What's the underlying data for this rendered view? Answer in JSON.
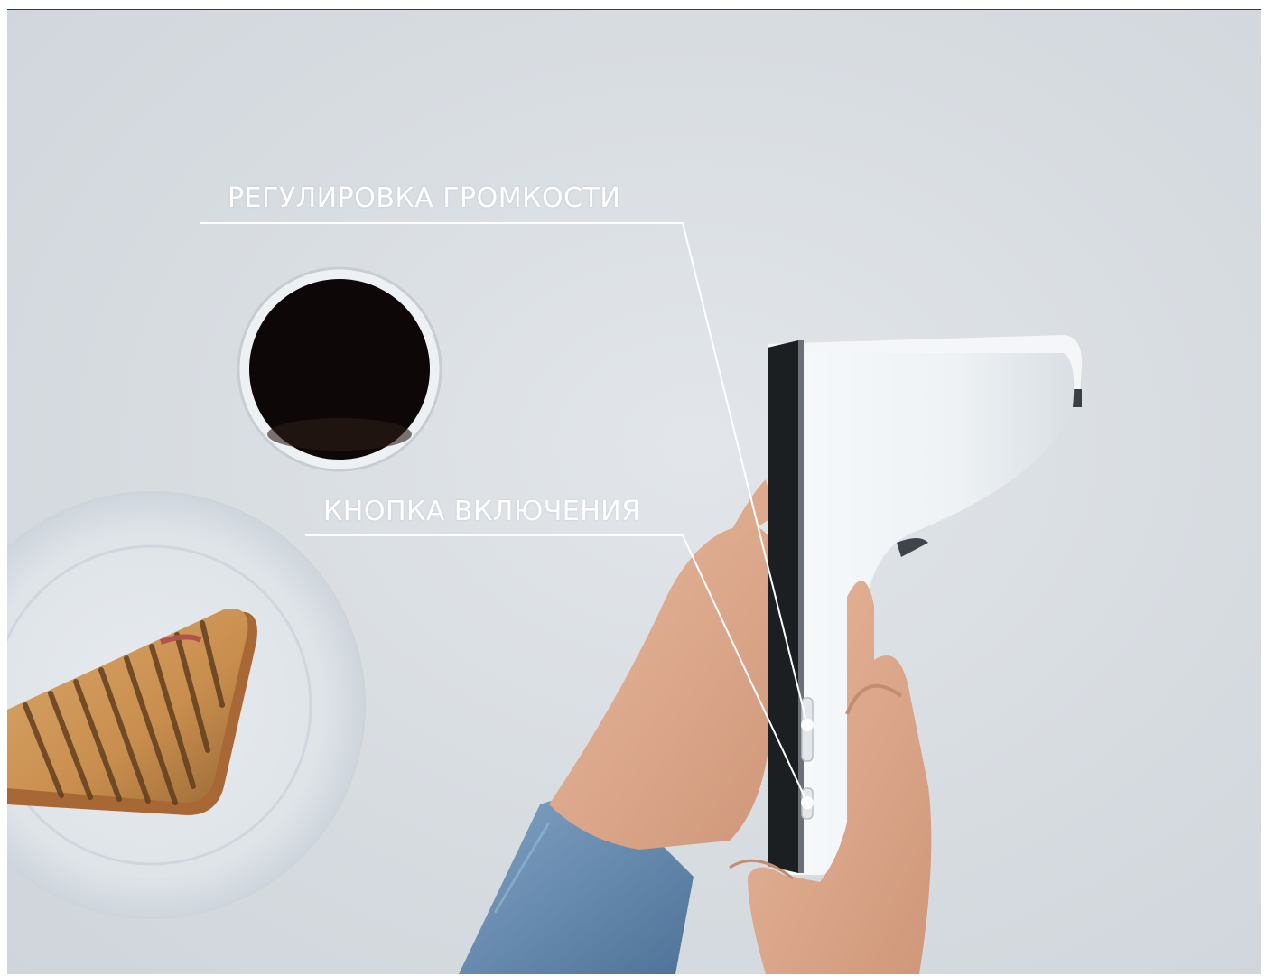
{
  "image": {
    "description_colors": {
      "background": "#d7dce1",
      "callout": "#ffffff"
    }
  },
  "callouts": {
    "volume_control": "РЕГУЛИРОВКА ГРОМКОСТИ",
    "power_button": "КНОПКА ВКЛЮЧЕНИЯ"
  }
}
